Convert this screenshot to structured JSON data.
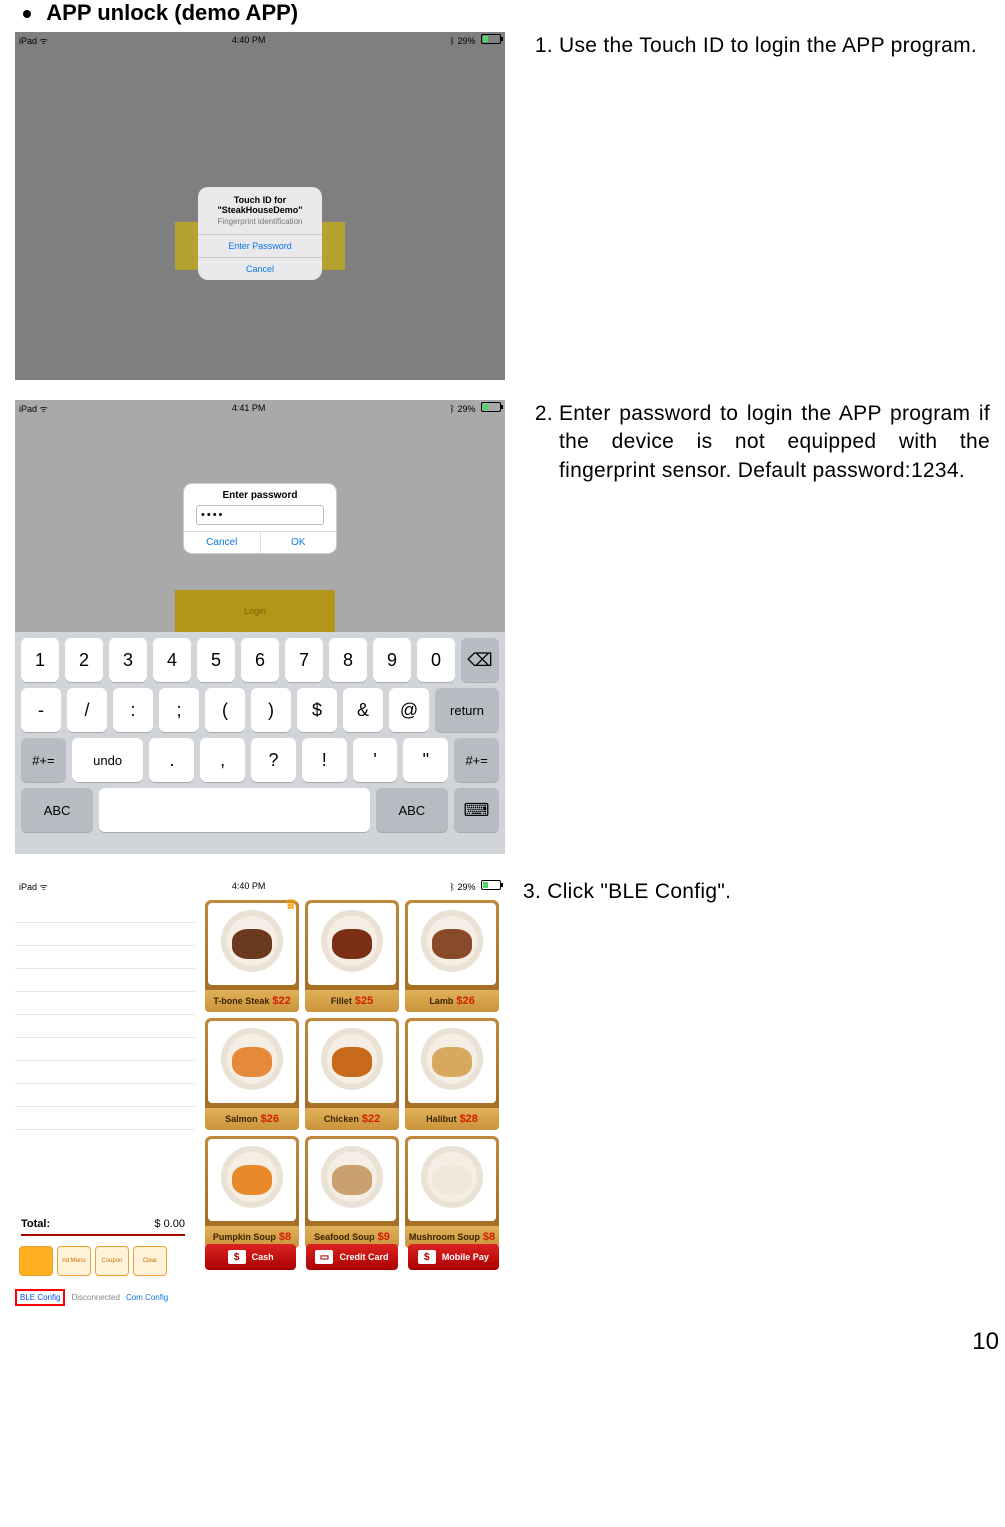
{
  "heading": "APP unlock (demo APP)",
  "page_number": "10",
  "step1": {
    "num": "1.",
    "text": "Use the Touch ID to login the APP program."
  },
  "step2": {
    "num": "2.",
    "text": "Enter password to login the APP program if the device is not equipped with the fingerprint sensor. Default password:1234."
  },
  "step3": {
    "text": "3. Click \"BLE Config\"."
  },
  "status": {
    "left": "iPad ᯤ",
    "t1": "4:40 PM",
    "t2": "4:41 PM",
    "t3": "4:40 PM",
    "right_pct": "29%",
    "bt": "ᛒ"
  },
  "shot1": {
    "title_line1": "Touch ID for",
    "title_line2": "\"SteakHouseDemo\"",
    "subtitle": "Fingerprint identification",
    "btn1": "Enter Password",
    "btn2": "Cancel"
  },
  "shot2": {
    "title": "Enter password",
    "masked": "••••",
    "cancel": "Cancel",
    "ok": "OK",
    "login": "Login",
    "row1": [
      "1",
      "2",
      "3",
      "4",
      "5",
      "6",
      "7",
      "8",
      "9",
      "0"
    ],
    "row2": [
      "-",
      "/",
      ":",
      ";",
      "(",
      ")",
      "$",
      "&",
      "@"
    ],
    "row2_return": "return",
    "row3_left": "#+=",
    "row3_undo": "undo",
    "row3_keys": [
      ".",
      ",",
      "?",
      "!",
      "'",
      "\""
    ],
    "row3_right": "#+=",
    "row4_abc": "ABC",
    "backspace": "⌫",
    "kbd_icon": "⌨"
  },
  "shot3": {
    "total_label": "Total:",
    "total_amount": "$ 0.00",
    "orange_btns": [
      "",
      "nd Menu",
      "Coupon",
      "Clear"
    ],
    "ble": "BLE Config",
    "disc": "Disconnected",
    "com": "Com Config",
    "items": [
      {
        "name": "T-bone Steak",
        "price": "$22",
        "color": "#6b3a1e",
        "crown": true
      },
      {
        "name": "Fillet",
        "price": "$25",
        "color": "#7a3015",
        "crown": false
      },
      {
        "name": "Lamb",
        "price": "$26",
        "color": "#8a4a2a",
        "crown": false
      },
      {
        "name": "Salmon",
        "price": "$26",
        "color": "#e48a3a",
        "crown": false
      },
      {
        "name": "Chicken",
        "price": "$22",
        "color": "#c96a1a",
        "crown": false
      },
      {
        "name": "Halibut",
        "price": "$28",
        "color": "#d8a860",
        "crown": false
      },
      {
        "name": "Pumpkin Soup",
        "price": "$8",
        "color": "#e88a2a",
        "crown": false
      },
      {
        "name": "Seafood Soup",
        "price": "$9",
        "color": "#caa070",
        "crown": false
      },
      {
        "name": "Mushroom Soup",
        "price": "$8",
        "color": "#efe9da",
        "crown": false
      }
    ],
    "pay": [
      {
        "icon": "$",
        "label": "Cash"
      },
      {
        "icon": "▭",
        "label": "Credit Card"
      },
      {
        "icon": "$",
        "label": "Mobile Pay"
      }
    ]
  }
}
